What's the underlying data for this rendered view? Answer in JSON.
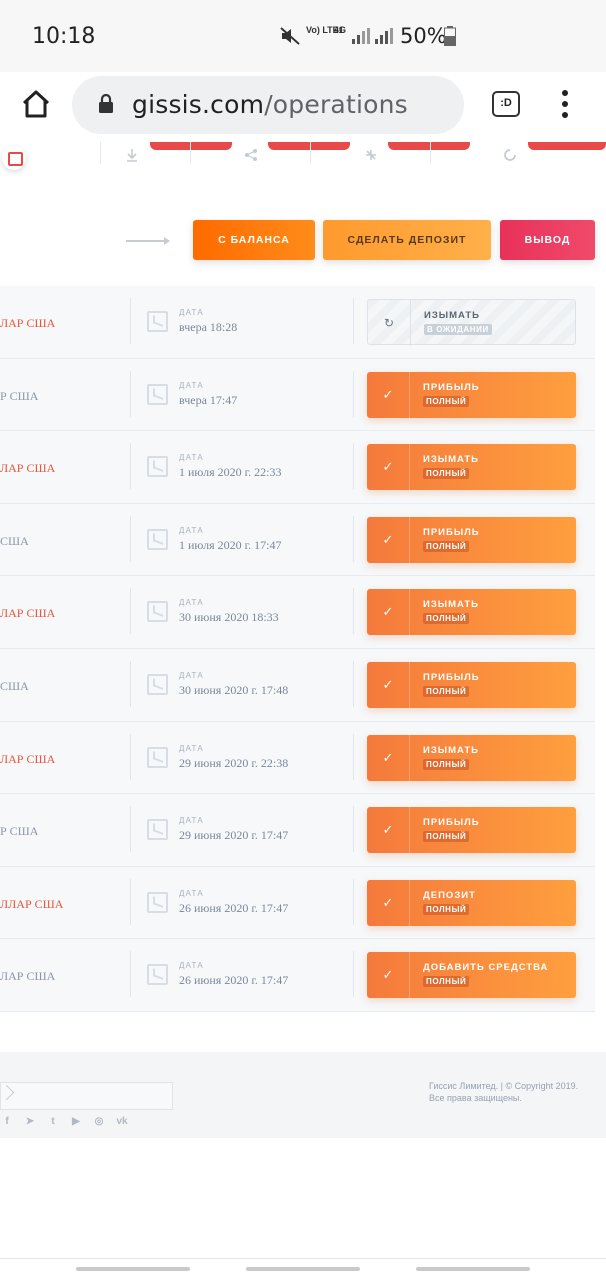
{
  "status_bar": {
    "time": "10:18",
    "volte": "Vo) LTE1",
    "network": "4G",
    "battery": "50%"
  },
  "browser": {
    "url_host": "gissis.com",
    "url_path": "/operations",
    "tab_switcher": ":D"
  },
  "actions": {
    "from_balance": "С БАЛАНСА",
    "make_deposit": "СДЕЛАТЬ ДЕПОЗИТ",
    "withdraw": "ВЫВОД"
  },
  "operations": [
    {
      "amount": "ЛАР США",
      "amount_red": true,
      "date_label": "ДАТА",
      "date": "вчера 18:28",
      "status": "ИЗЫМАТЬ",
      "badge": "В ОЖИДАНИИ",
      "pending": true
    },
    {
      "amount": "Р США",
      "amount_red": false,
      "date_label": "ДАТА",
      "date": "вчера 17:47",
      "status": "ПРИБЫЛЬ",
      "badge": "ПОЛНЫЙ",
      "pending": false
    },
    {
      "amount": "ЛАР США",
      "amount_red": true,
      "date_label": "ДАТА",
      "date": "1 июля 2020 г. 22:33",
      "status": "ИЗЫМАТЬ",
      "badge": "ПОЛНЫЙ",
      "pending": false
    },
    {
      "amount": "США",
      "amount_red": false,
      "date_label": "ДАТА",
      "date": "1 июля 2020 г. 17:47",
      "status": "ПРИБЫЛЬ",
      "badge": "ПОЛНЫЙ",
      "pending": false
    },
    {
      "amount": "ЛАР США",
      "amount_red": true,
      "date_label": "ДАТА",
      "date": "30 июня 2020 18:33",
      "status": "ИЗЫМАТЬ",
      "badge": "ПОЛНЫЙ",
      "pending": false
    },
    {
      "amount": "США",
      "amount_red": false,
      "date_label": "ДАТА",
      "date": "30 июня 2020 г. 17:48",
      "status": "ПРИБЫЛЬ",
      "badge": "ПОЛНЫЙ",
      "pending": false
    },
    {
      "amount": "ЛАР США",
      "amount_red": true,
      "date_label": "ДАТА",
      "date": "29 июня 2020 г. 22:38",
      "status": "ИЗЫМАТЬ",
      "badge": "ПОЛНЫЙ",
      "pending": false
    },
    {
      "amount": "Р США",
      "amount_red": false,
      "date_label": "ДАТА",
      "date": "29 июня 2020 г. 17:47",
      "status": "ПРИБЫЛЬ",
      "badge": "ПОЛНЫЙ",
      "pending": false
    },
    {
      "amount": "ЛЛАР США",
      "amount_red": true,
      "date_label": "ДАТА",
      "date": "26 июня 2020 г. 17:47",
      "status": "ДЕПОЗИТ",
      "badge": "ПОЛНЫЙ",
      "pending": false
    },
    {
      "amount": "ЛАР США",
      "amount_red": false,
      "date_label": "ДАТА",
      "date": "26 июня 2020 г. 17:47",
      "status": "ДОБАВИТЬ СРЕДСТВА",
      "badge": "ПОЛНЫЙ",
      "pending": false
    }
  ],
  "footer": {
    "copyright_line1": "Гиссис Лимитед. | © Copyright 2019.",
    "copyright_line2": "Все права защищены.",
    "social_icons": [
      "facebook-icon",
      "telegram-icon",
      "twitter-icon",
      "youtube-icon",
      "instagram-icon",
      "vk-icon"
    ],
    "social_glyphs": [
      "f",
      "➤",
      "t",
      "▶",
      "◎",
      "vk"
    ]
  },
  "colors": {
    "accent_orange": "#ff7a1a",
    "withdraw_red": "#e8315a",
    "amount_red": "#e8553a"
  }
}
